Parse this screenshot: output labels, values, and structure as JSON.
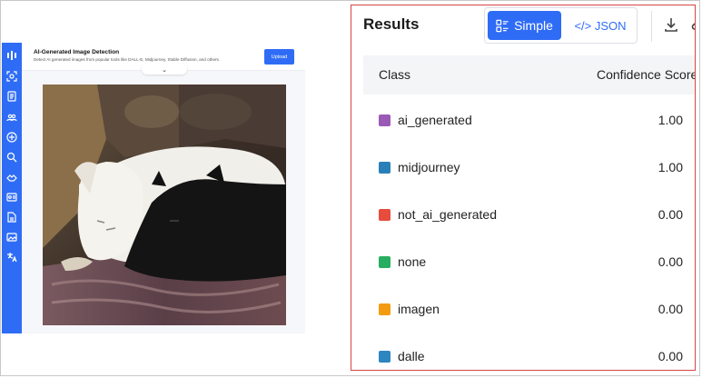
{
  "mini_app": {
    "title": "AI-Generated Image Detection",
    "subtitle": "Detect AI generated images from popular tools like DALL-E, Midjourney, Stable Diffusion, and others.",
    "upload_label": "Upload",
    "collapse_icon": "chevron-down-icon",
    "rail_icons": [
      "logo-icon",
      "scan-icon",
      "document-icon",
      "people-icon",
      "circle-grid-icon",
      "search-icon",
      "hands-icon",
      "id-card-icon",
      "file-icon",
      "image-icon",
      "translate-icon"
    ],
    "image_alt": "White dog and black cat sleeping on a patterned blanket"
  },
  "results": {
    "title": "Results",
    "view_simple": "Simple",
    "view_json": "</> JSON",
    "active_view": "Simple",
    "column_class": "Class",
    "column_score": "Confidence Score",
    "rows": [
      {
        "name": "ai_generated",
        "score": "1.00",
        "color": "#9b59b6"
      },
      {
        "name": "midjourney",
        "score": "1.00",
        "color": "#2980b9"
      },
      {
        "name": "not_ai_generated",
        "score": "0.00",
        "color": "#e74c3c"
      },
      {
        "name": "none",
        "score": "0.00",
        "color": "#27ae60"
      },
      {
        "name": "imagen",
        "score": "0.00",
        "color": "#f39c12"
      },
      {
        "name": "dalle",
        "score": "0.00",
        "color": "#2e86c1"
      }
    ]
  },
  "colors": {
    "accent": "#2f6cf6",
    "highlight_border": "#d64545"
  }
}
